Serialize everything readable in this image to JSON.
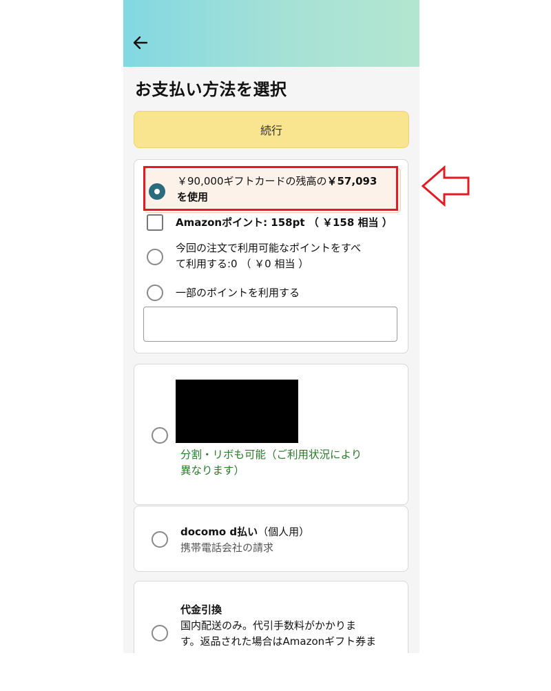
{
  "header": {
    "back_icon": "arrow-left-icon",
    "title": "お支払い方法を選択"
  },
  "continue_button": {
    "label": "続行"
  },
  "gift_card": {
    "selected": true,
    "line1_prefix": "￥90,000ギフトカードの残高の",
    "line1_amount": "￥57,093",
    "line2": "を使用"
  },
  "amazon_points": {
    "label": "Amazonポイント: 158pt （ ￥158 相当 ）",
    "checked": false
  },
  "point_options": [
    {
      "line1": "今回の注文で利用可能なポイントをすべ",
      "line2": "て利用する:0 （ ￥0 相当 ）"
    },
    {
      "line1": "一部のポイントを利用する",
      "line2": ""
    }
  ],
  "points_input": {
    "value": "",
    "placeholder": ""
  },
  "credit_card": {
    "note_line1": "分割・リボも可能（ご利用状況により",
    "note_line2": "異なります）"
  },
  "docomo": {
    "title": "docomo d払い",
    "title_suffix": "（個人用）",
    "subtitle": "携帯電話会社の請求"
  },
  "cod": {
    "title": "代金引換",
    "line1": "国内配送のみ。代引手数料がかかりま",
    "line2": "す。返品された場合はAmazonギフト券ま"
  },
  "annotation": {
    "highlight_color": "#e21b23",
    "arrow_icon": "left-arrow-outline-icon"
  },
  "colors": {
    "accent": "#2a6b7d",
    "button": "#f9e490",
    "green_note": "#2a7a2a"
  }
}
